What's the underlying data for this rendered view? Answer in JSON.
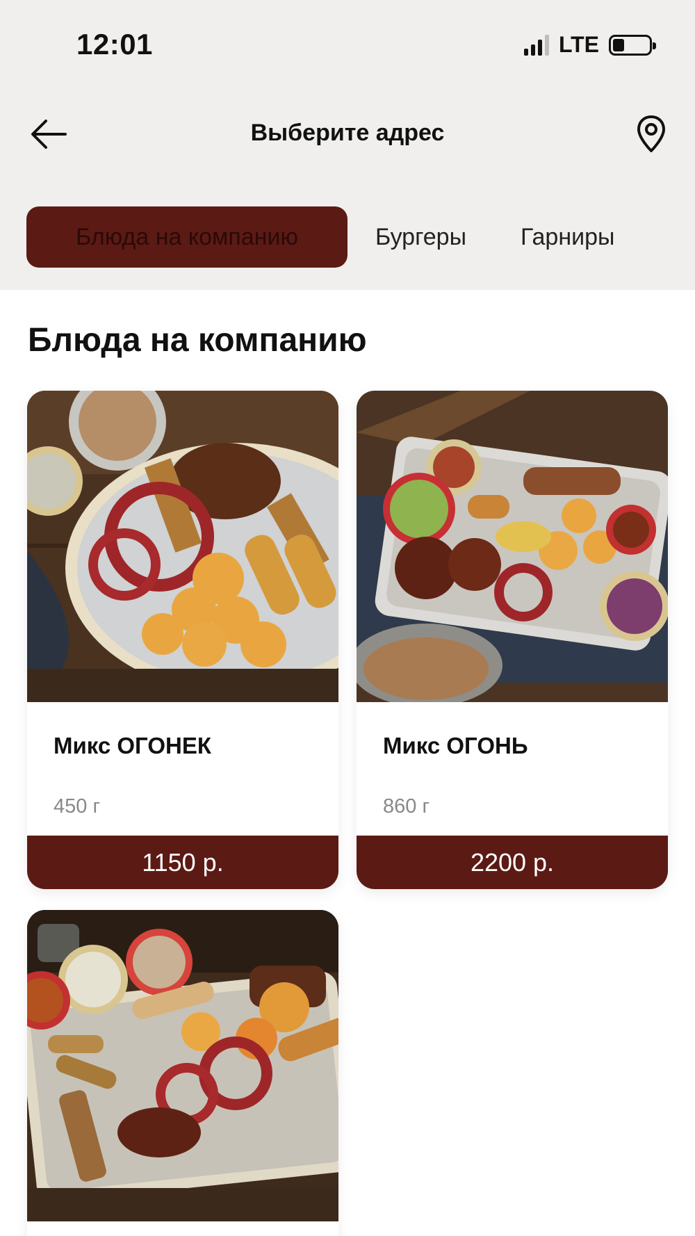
{
  "status_bar": {
    "time": "12:01",
    "network": "LTE",
    "signal_icon": "signal-bars-icon",
    "battery_icon": "battery-icon"
  },
  "header": {
    "title": "Выберите адрес",
    "back_icon": "arrow-left-icon",
    "location_icon": "map-pin-icon"
  },
  "tabs": [
    {
      "label": "Блюда на компанию",
      "active": true
    },
    {
      "label": "Бургеры",
      "active": false
    },
    {
      "label": "Гарниры",
      "active": false
    }
  ],
  "section": {
    "title": "Блюда на компанию"
  },
  "products": [
    {
      "name": "Микс ОГОНЕК",
      "weight": "450 г",
      "price": "1150 р."
    },
    {
      "name": "Микс ОГОНЬ",
      "weight": "860 г",
      "price": "2200 р."
    },
    {
      "name": "",
      "weight": "",
      "price": ""
    }
  ],
  "colors": {
    "accent": "#5c1a14",
    "background_top": "#f0efed",
    "background": "#ffffff"
  }
}
